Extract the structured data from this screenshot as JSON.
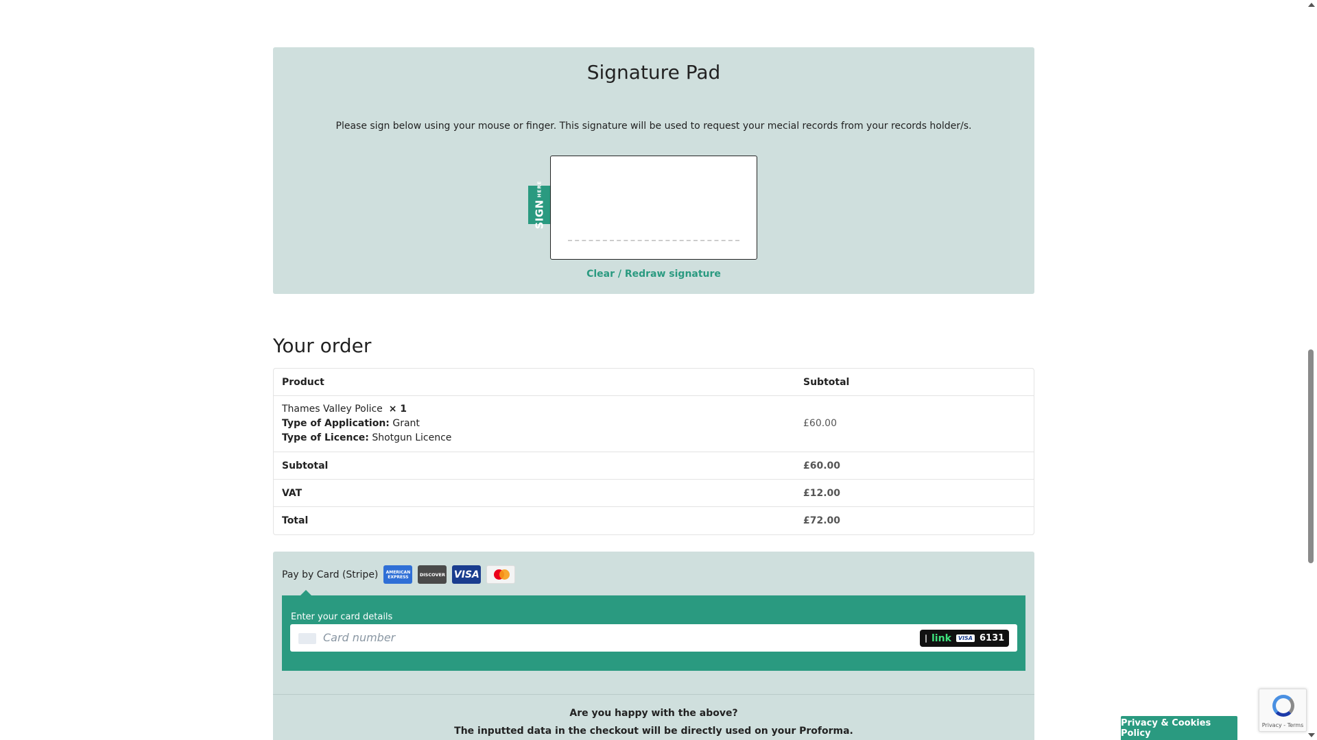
{
  "signature": {
    "title": "Signature Pad",
    "instructions": "Please sign below using your mouse or finger. This signature will be used to request your mecial records from your records holder/s.",
    "tag_big": "SIGN",
    "tag_small": "HERE",
    "clear_label": "Clear / Redraw signature"
  },
  "order": {
    "heading": "Your order",
    "columns": [
      "Product",
      "Subtotal"
    ],
    "item": {
      "name": "Thames Valley Police",
      "qty": "× 1",
      "app_label": "Type of Application:",
      "app_value": "Grant",
      "licence_label": "Type of Licence:",
      "licence_value": "Shotgun Licence",
      "price": "£60.00"
    },
    "totals": [
      {
        "label": "Subtotal",
        "value": "£60.00"
      },
      {
        "label": "VAT",
        "value": "£12.00"
      },
      {
        "label": "Total",
        "value": "£72.00"
      }
    ]
  },
  "payment": {
    "method_label": "Pay by Card (Stripe)",
    "cards": {
      "amex": "AMERICAN EXPRESS",
      "discover": "DISCOVER",
      "visa": "VISA"
    },
    "details_label": "Enter your card details",
    "card_placeholder": "Card number",
    "link_label": "link",
    "link_visa": "VISA",
    "link_last4": "6131",
    "confirm_question": "Are you happy with the above?",
    "confirm_text": "The inputted data in the checkout will be directly used on your Proforma."
  },
  "recaptcha": {
    "text": "Privacy - Terms"
  },
  "cookie_button": "Privacy & Cookies Policy",
  "colors": {
    "accent": "#2a9a80",
    "panel": "#cfdfdd"
  }
}
